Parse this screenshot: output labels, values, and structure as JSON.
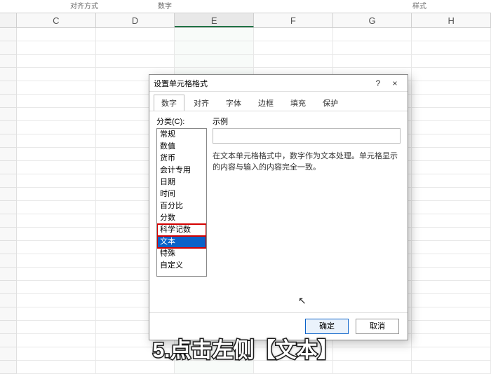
{
  "ribbon": {
    "label_align": "对齐方式",
    "label_number": "数字",
    "label_style": "样式"
  },
  "columns": [
    "C",
    "D",
    "E",
    "F",
    "G",
    "H"
  ],
  "active_column": "E",
  "dialog": {
    "title": "设置单元格格式",
    "help": "?",
    "close": "×",
    "tabs": [
      "数字",
      "对齐",
      "字体",
      "边框",
      "填充",
      "保护"
    ],
    "active_tab": 0,
    "category_label": "分类(C):",
    "categories": [
      "常规",
      "数值",
      "货币",
      "会计专用",
      "日期",
      "时间",
      "百分比",
      "分数",
      "科学记数",
      "文本",
      "特殊",
      "自定义"
    ],
    "selected_category_index": 9,
    "highlighted_indices": [
      8,
      9
    ],
    "sample_label": "示例",
    "description": "在文本单元格格式中，数字作为文本处理。单元格显示的内容与输入的内容完全一致。",
    "ok": "确定",
    "cancel": "取消"
  },
  "caption": "5.点击左侧【文本】"
}
